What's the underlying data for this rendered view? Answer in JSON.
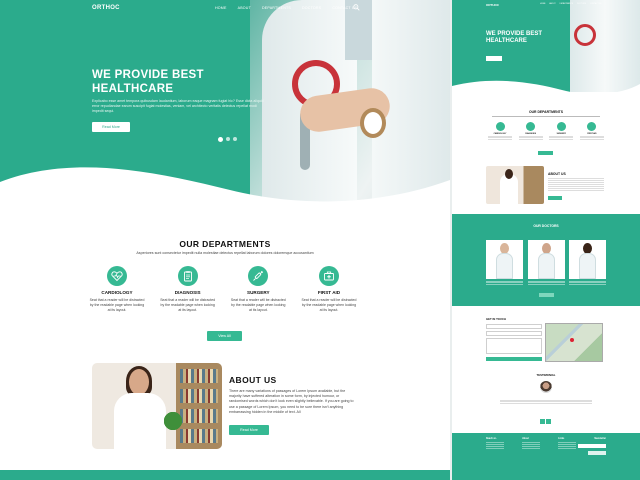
{
  "main": {
    "brand": "ORTHOC",
    "nav": [
      "HOME",
      "ABOUT",
      "DEPARTMENTS",
      "DOCTORS",
      "CONTACT US"
    ],
    "hero": {
      "title": "WE PROVIDE BEST HEALTHCARE",
      "text": "Explicabo esse amet tempora quibusdam laudantium, laborum eaque magnam fugiat hic? Esse dicta aliquid error repudiandae earum suscipit fugiat molestias, veniam, vel architecto veritatis delectus repellat modi impedit sequi.",
      "button": "Read More",
      "slides": 3,
      "active_slide": 1
    },
    "departments": {
      "title": "OUR DEPARTMENTS",
      "subtitle": "Asperiores sunt consectetur impedit nulla molestiae delectus repellat laborum dolores doloremque accusantium",
      "items": [
        {
          "name": "CARDIOLOGY",
          "icon": "heart-pulse-icon",
          "desc": "Seat that a reader will be distracted by the readable page when looking at its layout."
        },
        {
          "name": "DIAGNOSIS",
          "icon": "clipboard-icon",
          "desc": "Seat that a reader will be distracted by the readable page when looking at its layout."
        },
        {
          "name": "SURGERY",
          "icon": "syringe-icon",
          "desc": "Seat that a reader will be distracted by the readable page when looking at its layout."
        },
        {
          "name": "FIRST AID",
          "icon": "first-aid-kit-icon",
          "desc": "Seat that a reader will be distracted by the readable page when looking at its layout."
        }
      ],
      "button": "View All"
    },
    "about": {
      "title": "ABOUT US",
      "text": "There are many variations of passages of Lorem Ipsum available, but the majority have suffered alteration in some form, by injected humour, or randomised words which don't look even slightly believable. If you are going to use a passage of Lorem Ipsum, you need to be sure there isn't anything embarrassing hidden in the middle of text. All",
      "button": "Read More"
    }
  },
  "side": {
    "brand": "ORTHOC",
    "hero_title": "WE PROVIDE BEST HEALTHCARE",
    "departments_title": "OUR DEPARTMENTS",
    "dept_names": [
      "CARDIOLOGY",
      "DIAGNOSIS",
      "SURGERY",
      "FIRST AID"
    ],
    "about_title": "ABOUT US",
    "doctors_title": "OUR DOCTORS",
    "contact_title": "GET IN TOUCH",
    "testimonial_title": "TESTIMONIAL",
    "footer_cols": [
      "Reach at..",
      "About",
      "Links",
      "Newsletter"
    ]
  },
  "colors": {
    "accent": "#2bab8c",
    "accent_light": "#36b993",
    "stethoscope": "#c8333a"
  }
}
